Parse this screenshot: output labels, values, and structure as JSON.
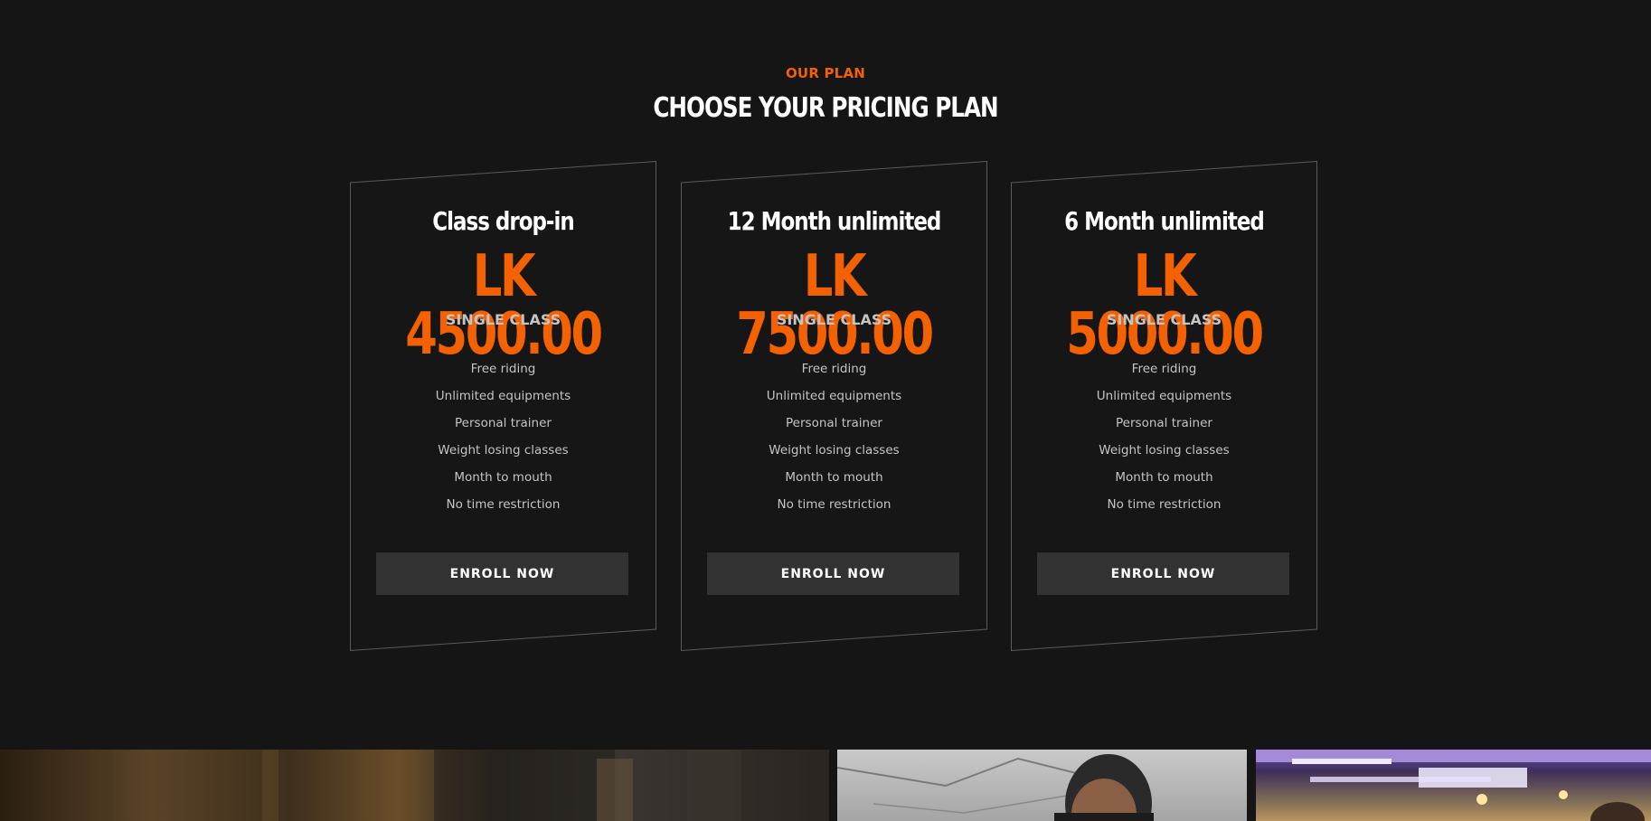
{
  "header": {
    "eyebrow": "OUR PLAN",
    "title": "CHOOSE YOUR PRICING PLAN"
  },
  "plans": [
    {
      "name": "Class drop-in",
      "price": "LK 4500.00",
      "unit": "SINGLE CLASS",
      "features": [
        "Free riding",
        "Unlimited equipments",
        "Personal trainer",
        "Weight losing classes",
        "Month to mouth",
        "No time restriction"
      ],
      "button": "ENROLL NOW"
    },
    {
      "name": "12 Month unlimited",
      "price": "LK 7500.00",
      "unit": "SINGLE CLASS",
      "features": [
        "Free riding",
        "Unlimited equipments",
        "Personal trainer",
        "Weight losing classes",
        "Month to mouth",
        "No time restriction"
      ],
      "button": "ENROLL NOW"
    },
    {
      "name": "6 Month unlimited",
      "price": "LK 5000.00",
      "unit": "SINGLE CLASS",
      "features": [
        "Free riding",
        "Unlimited equipments",
        "Personal trainer",
        "Weight losing classes",
        "Month to mouth",
        "No time restriction"
      ],
      "button": "ENROLL NOW"
    }
  ],
  "colors": {
    "accent": "#f36100",
    "background": "#151515",
    "button": "#323232"
  }
}
